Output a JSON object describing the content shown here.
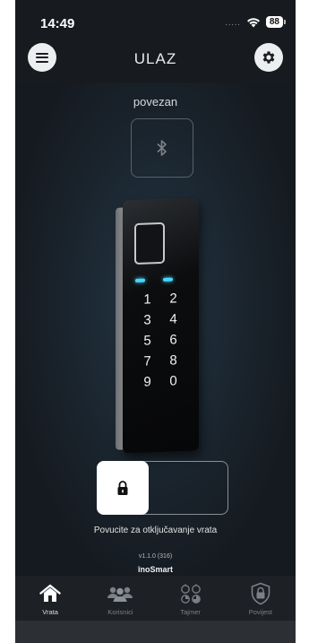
{
  "status_bar": {
    "time": "14:49",
    "battery": "88",
    "signal_dots": "....."
  },
  "header": {
    "title": "ULAZ"
  },
  "icons": {
    "menu": "hamburger-icon",
    "settings": "gear-icon",
    "bluetooth": "bluetooth-icon",
    "lock": "lock-icon"
  },
  "connection": {
    "status": "povezan"
  },
  "keypad": {
    "keys": [
      "1",
      "2",
      "3",
      "4",
      "5",
      "6",
      "7",
      "8",
      "9",
      "0"
    ]
  },
  "unlock": {
    "hint": "Povucite za otključavanje vrata"
  },
  "footer": {
    "version": "v1.1.0 (316)",
    "brand": "înoSmart"
  },
  "tabbar": {
    "items": [
      {
        "label": "Vrata",
        "icon": "home-icon",
        "active": true
      },
      {
        "label": "Korisnici",
        "icon": "users-icon",
        "active": false
      },
      {
        "label": "Tajmer",
        "icon": "timer-icon",
        "active": false
      },
      {
        "label": "Povijest",
        "icon": "shield-lock-icon",
        "active": false
      }
    ]
  },
  "colors": {
    "background": "#171a1e",
    "led": "#49d6ff",
    "accent_white": "#ffffff"
  }
}
